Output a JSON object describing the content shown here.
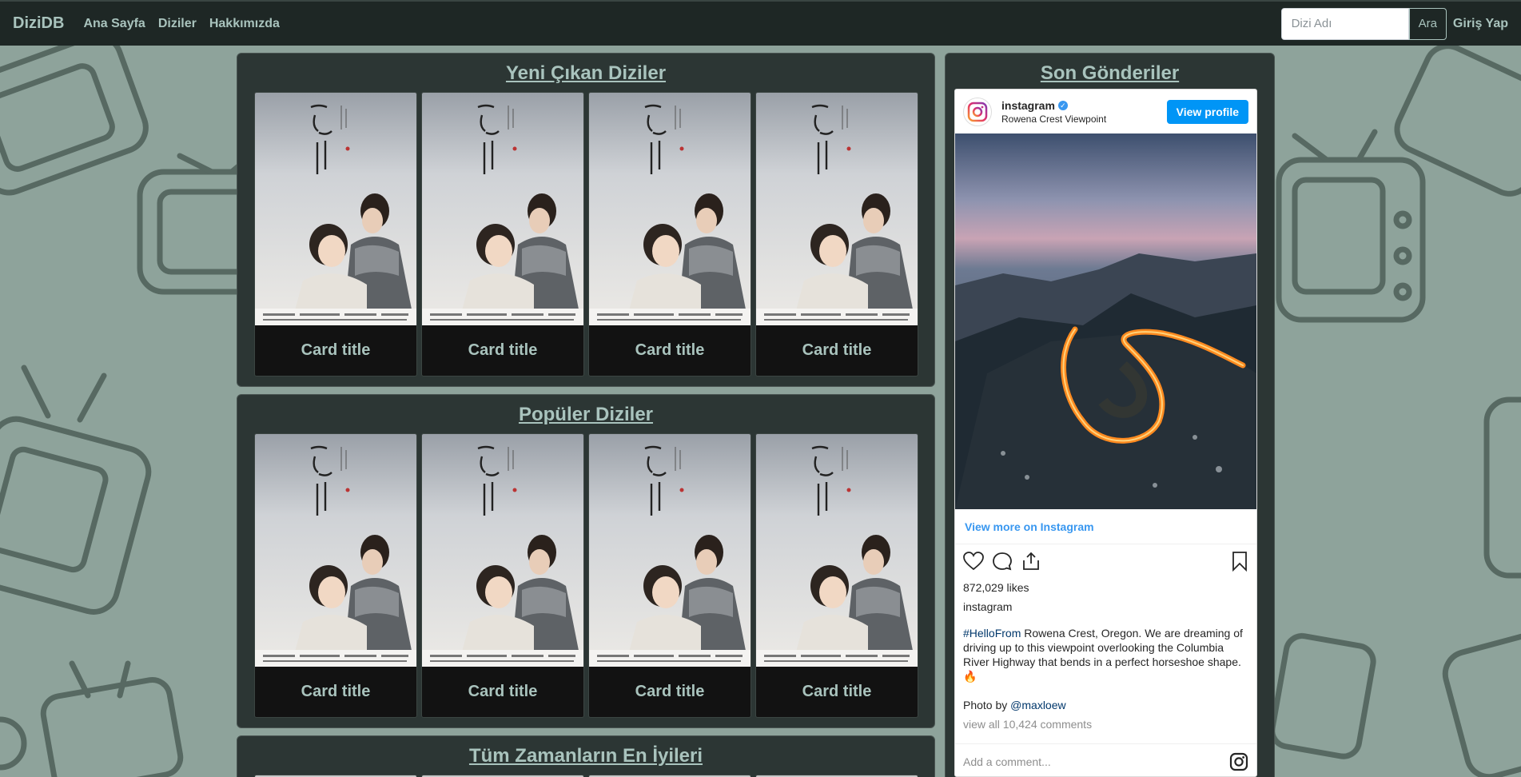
{
  "navbar": {
    "brand": "DiziDB",
    "links": [
      "Ana Sayfa",
      "Diziler",
      "Hakkımızda"
    ],
    "search_placeholder": "Dizi Adı",
    "search_button": "Ara",
    "login": "Giriş Yap"
  },
  "sections": [
    {
      "title": "Yeni Çıkan Diziler",
      "cards": [
        "Card title",
        "Card title",
        "Card title",
        "Card title"
      ]
    },
    {
      "title": "Popüler Diziler",
      "cards": [
        "Card title",
        "Card title",
        "Card title",
        "Card title"
      ]
    },
    {
      "title": "Tüm Zamanların En İyileri"
    }
  ],
  "sidebar": {
    "title": "Son Gönderiler"
  },
  "instagram": {
    "username": "instagram",
    "location": "Rowena Crest Viewpoint",
    "view_profile": "View profile",
    "view_more": "View more on Instagram",
    "likes": "872,029 likes",
    "caption_user": "instagram",
    "caption_tag": "#HelloFrom",
    "caption_text": " Rowena Crest, Oregon. We are dreaming of driving up to this viewpoint overlooking the Columbia River Highway that bends in a perfect horseshoe shape. 🔥",
    "photo_by": "Photo by ",
    "photo_by_handle": "@maxloew",
    "comments": "view all 10,424 comments",
    "add_comment": "Add a comment...",
    "accent_color": "#0095f6"
  },
  "colors": {
    "background": "#8ea39b",
    "navbar": "#1e2725",
    "panel": "#2c3634",
    "accent_text": "#a9c3bd",
    "card": "#121212"
  }
}
